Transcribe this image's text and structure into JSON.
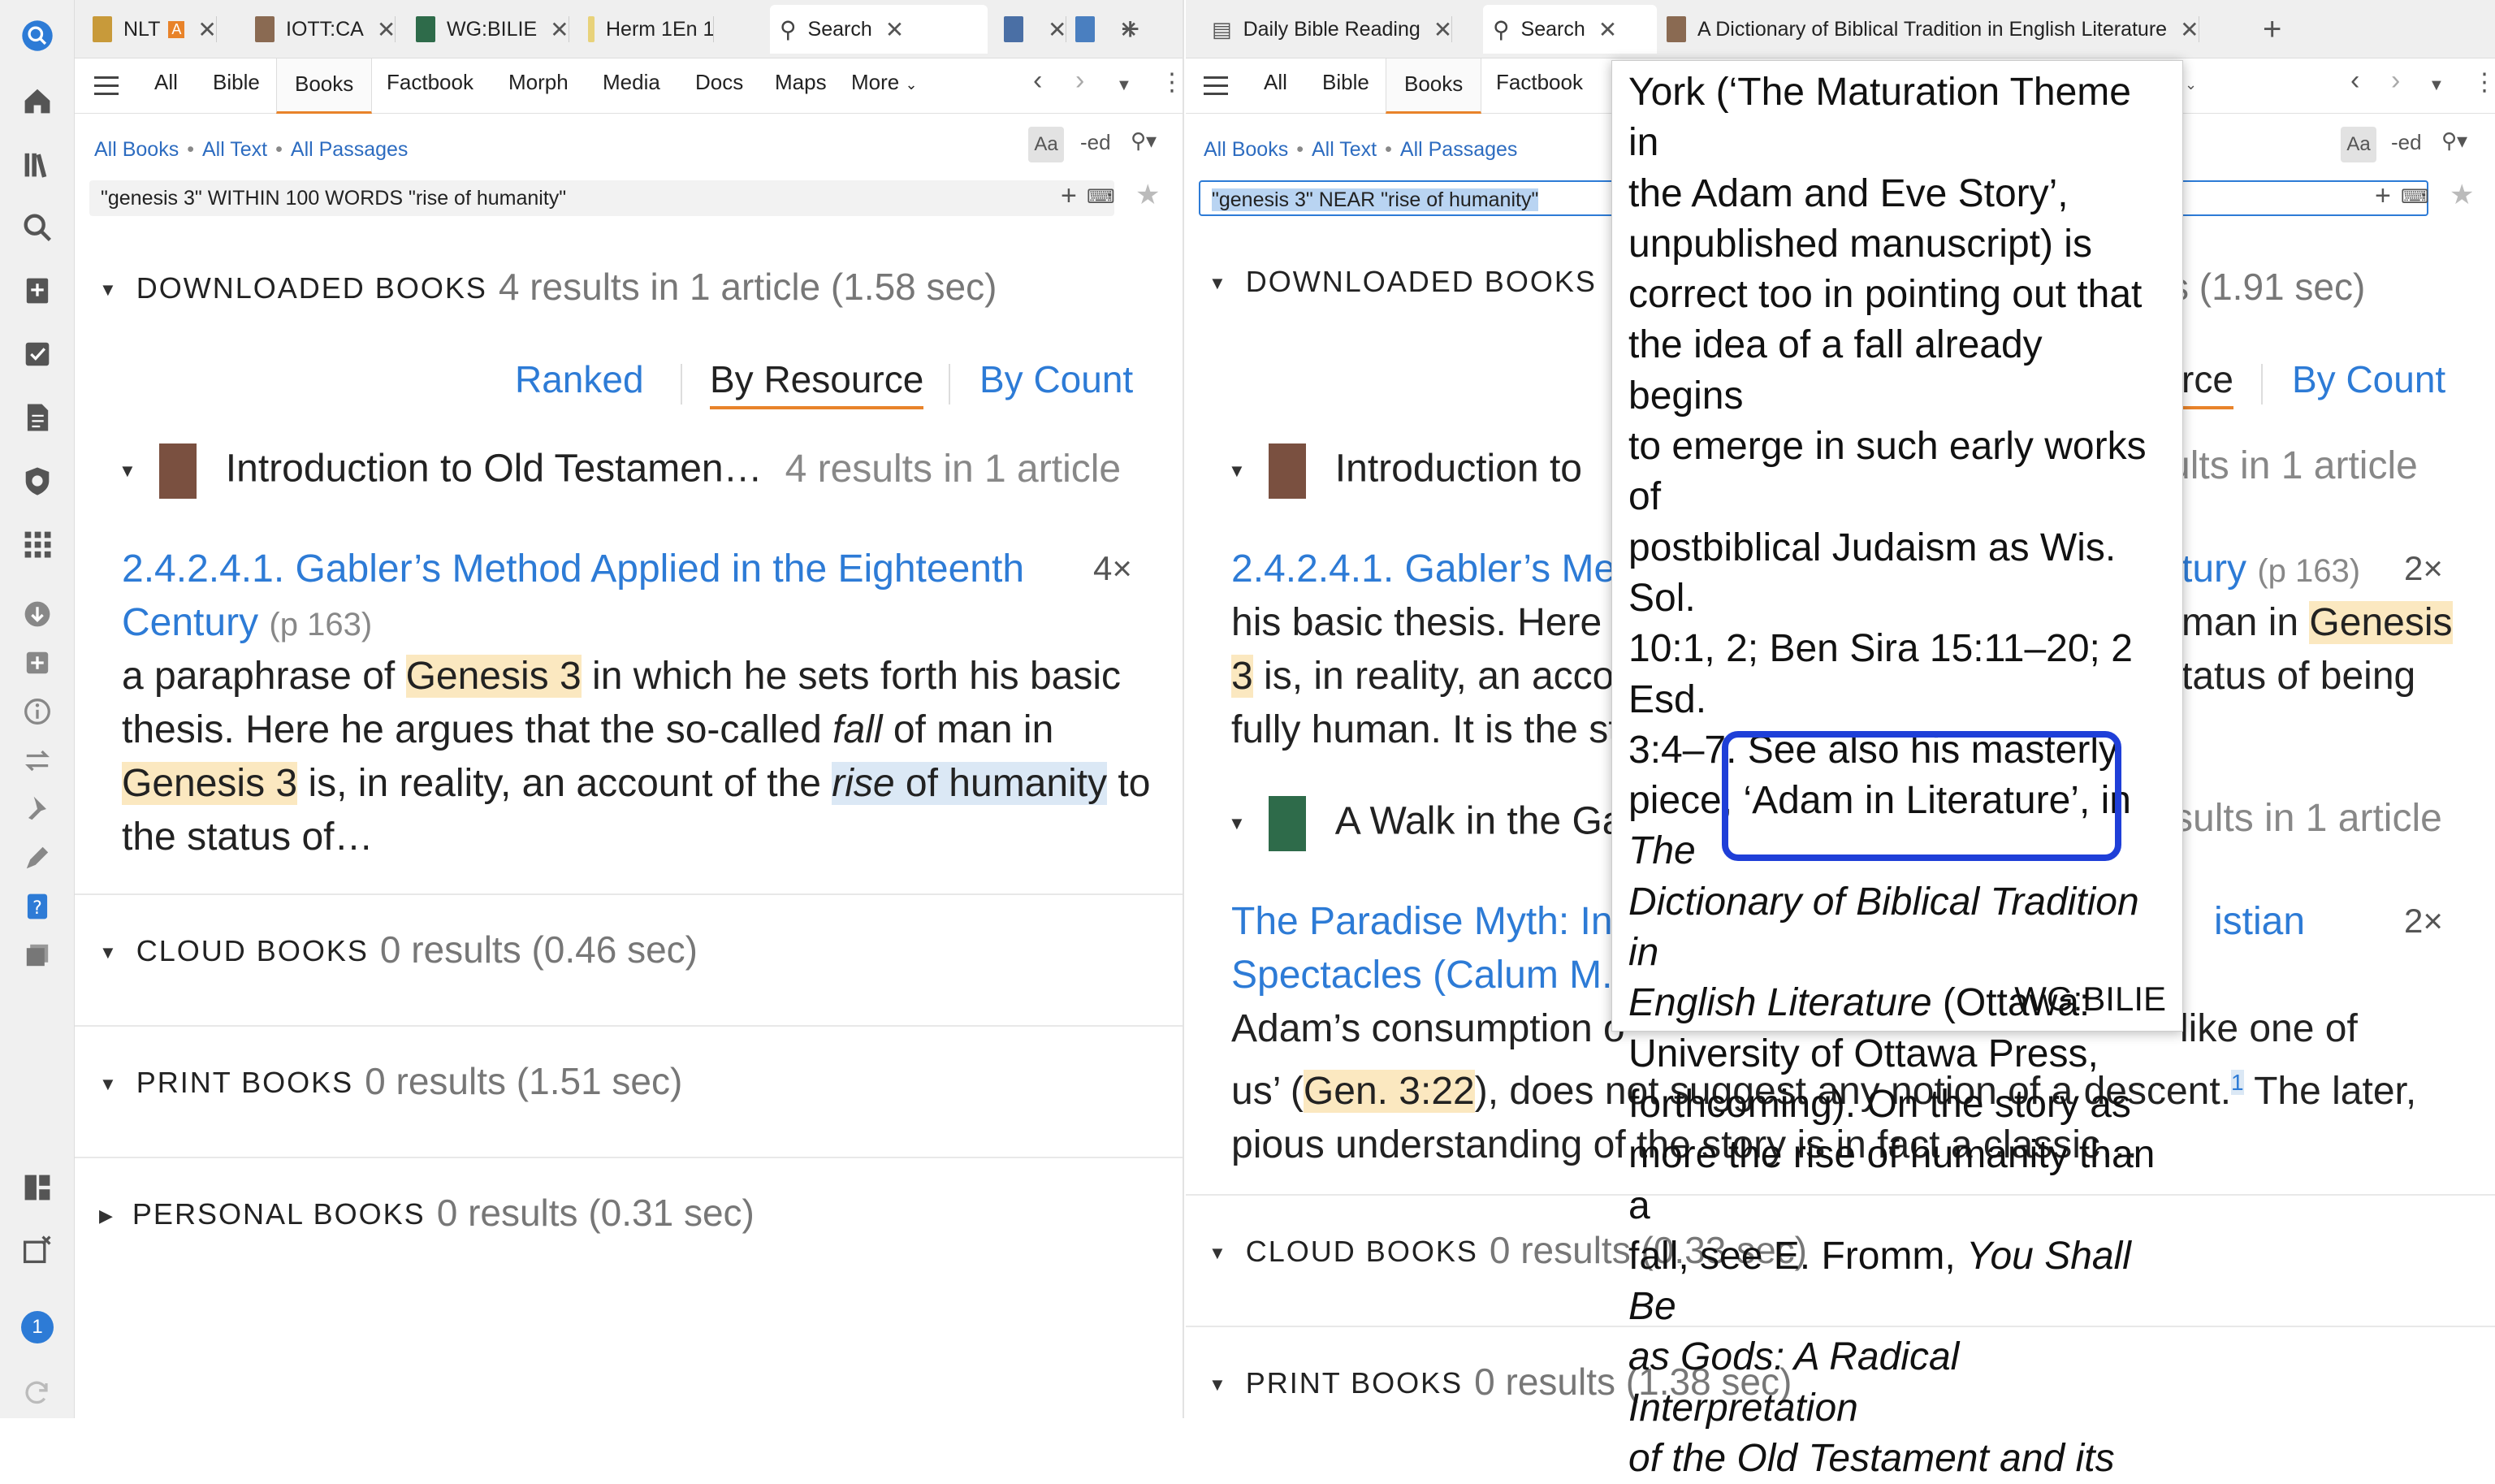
{
  "left_pane": {
    "tabs": [
      {
        "label": "NLT",
        "color": "#c89a3a"
      },
      {
        "label": "IOTT:CA",
        "color": "#8a6a52"
      },
      {
        "label": "WG:BILIE",
        "color": "#2e6b4a"
      },
      {
        "label": "Herm 1En 1",
        "color": "#e8d27a"
      },
      {
        "label": "Search",
        "color": "#555555"
      },
      {
        "label": "",
        "color": "#4a6fa5"
      },
      {
        "label": "",
        "color": "#4a7fc0"
      }
    ],
    "toolbar": [
      "All",
      "Bible",
      "Books",
      "Factbook",
      "Morph",
      "Media",
      "Docs",
      "Maps",
      "More"
    ],
    "scope": [
      "All Books",
      "All Text",
      "All Passages"
    ],
    "query": "\"genesis 3\" WITHIN 100 WORDS \"rise of humanity\"",
    "downloaded": {
      "label": "DOWNLOADED BOOKS",
      "meta": "4 results in 1 article (1.58 sec)"
    },
    "modes": [
      "Ranked",
      "By Resource",
      "By Count"
    ],
    "book": {
      "title": "Introduction to Old Testamen…",
      "meta": "4 results in 1 article"
    },
    "result": {
      "title1": "2.4.2.4.1. Gabler’s Method Applied in the Eighteenth",
      "title2": "Century",
      "page": "(p 163)",
      "count": "4×",
      "s1a": "a paraphrase of ",
      "s1b": "Genesis 3",
      "s1c": " in which he sets forth his basic",
      "s2a": "thesis. Here he argues that the so-called ",
      "s2b": "fall",
      "s2c": " of man in",
      "s3a": "Genesis 3",
      "s3b": " is, in reality, an account of the ",
      "s3c": "rise",
      "s3d": " of humanity",
      "s3e": " to",
      "s4": "the status of…"
    },
    "cloud": {
      "label": "CLOUD BOOKS",
      "meta": "0 results (0.46 sec)"
    },
    "print": {
      "label": "PRINT BOOKS",
      "meta": "0 results (1.51 sec)"
    },
    "personal": {
      "label": "PERSONAL BOOKS",
      "meta": "0 results (0.31 sec)"
    }
  },
  "right_pane": {
    "tabs": [
      {
        "label": "Daily Bible Reading",
        "color": "#555555"
      },
      {
        "label": "Search",
        "color": "#555555"
      },
      {
        "label": "A Dictionary of Biblical Tradition in English Literature",
        "color": "#8a6a52"
      }
    ],
    "toolbar": [
      "All",
      "Bible",
      "Books",
      "Factbook"
    ],
    "scope": [
      "All Books",
      "All Text",
      "All Passages"
    ],
    "query": "\"genesis 3\" NEAR \"rise of humanity\"",
    "downloaded": {
      "label": "DOWNLOADED BOOKS",
      "meta_tail": "s (1.91 sec)"
    },
    "modes": [
      "rce",
      "By Count"
    ],
    "book1": {
      "title": "Introduction to",
      "meta": "ults in 1 article"
    },
    "result1": {
      "title_a": "2.4.2.4.1. Gabler’s Meth",
      "title_b": "tury",
      "page": "(p 163)",
      "count": "2×",
      "l1a": "his basic thesis. Here h",
      "l1b": "man in ",
      "l1c": "Genesis",
      "l2a": "3",
      "l2b": " is, in reality, an accou",
      "l2c": "tatus of being",
      "l3": "fully human. It is the st"
    },
    "book2": {
      "title": "A Walk in the Ga",
      "meta": "sults in 1 article"
    },
    "result2": {
      "title_a": "The Paradise Myth: Int",
      "title_b": "istian",
      "title_c": "Spectacles (Calum M. C",
      "count": "2×",
      "l1a": "Adam’s consumption o",
      "l1b": "like one of",
      "l2a": "us’ (",
      "l2b": "Gen. 3:22",
      "l2c": "), does not suggest any notion of a descent.",
      "l2d": "1",
      "l2e": " The later,",
      "l3": "pious understanding of the story is in fact a classic…"
    },
    "cloud": {
      "label": "CLOUD BOOKS",
      "meta": "0 results (0.33 sec)"
    },
    "print": {
      "label": "PRINT BOOKS",
      "meta": "0 results (1.38 sec)"
    }
  },
  "popup": {
    "lines": [
      "York (‘The Maturation Theme in",
      "the Adam and Eve Story’,",
      "unpublished manuscript) is",
      "correct too in pointing out that",
      "the idea of a fall already begins",
      "to emerge in such early works of",
      "postbiblical Judaism as Wis. Sol.",
      "10:1, 2; Ben Sira 15:11–20; 2 Esd.",
      "3:4–7. See also his masterly",
      "piece, ‘Adam in Literature’, in "
    ],
    "italic1": "The",
    "italic2": "Dictionary of Biblical Tradition in",
    "italic3": "English Literature",
    "after_italic3": " (Ottawa:",
    "line14": "University of Ottawa Press,",
    "line15": "forthcoming). On the story as",
    "line16": "more the rise of humanity than a",
    "line17a": "fall, see E. Fromm, ",
    "line17b": "You Shall Be",
    "line18": "as Gods: A Radical Interpretation",
    "line19": "of the Old Testament and its",
    "source": "WG:BILIE"
  },
  "rail": {
    "notification_count": "1"
  }
}
